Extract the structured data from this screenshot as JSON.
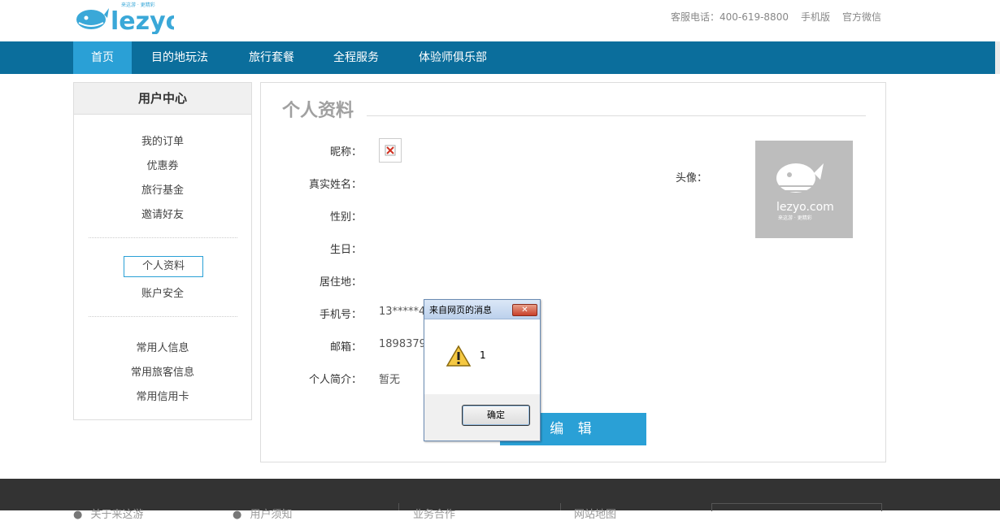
{
  "header": {
    "logo_text": "lezyo",
    "logo_tagline": "来这游 · 更精彩",
    "hotline": "客服电话：400-619-8800",
    "mobile": "手机版",
    "wechat": "官方微信"
  },
  "nav": {
    "items": [
      "首页",
      "目的地玩法",
      "旅行套餐",
      "全程服务",
      "体验师俱乐部"
    ],
    "active_index": 0
  },
  "sidebar": {
    "title": "用户中心",
    "group1": [
      "我的订单",
      "优惠券",
      "旅行基金",
      "邀请好友"
    ],
    "group2": [
      "个人资料",
      "账户安全"
    ],
    "group3": [
      "常用人信息",
      "常用旅客信息",
      "常用信用卡"
    ],
    "active_item": "个人资料"
  },
  "profile": {
    "title": "个人资料",
    "fields": [
      {
        "label": "昵称：",
        "value": ""
      },
      {
        "label": "真实姓名：",
        "value": ""
      },
      {
        "label": "性别：",
        "value": ""
      },
      {
        "label": "生日：",
        "value": ""
      },
      {
        "label": "居住地：",
        "value": ""
      },
      {
        "label": "手机号：",
        "value": "13*****4"
      },
      {
        "label": "邮箱：",
        "value": "1898379"
      },
      {
        "label": "个人简介：",
        "value": "暂无"
      }
    ],
    "avatar_label": "头像：",
    "avatar_brand": "lezyo.com",
    "avatar_tagline": "来这游 · 更精彩",
    "edit_button": "编 辑"
  },
  "dialog": {
    "title": "来自网页的消息",
    "message": "1",
    "ok_label": "确定",
    "close_label": "✕"
  },
  "footer": {
    "items": [
      "关于来这游",
      "用户须知",
      "业务合作",
      "网站地图"
    ]
  },
  "colors": {
    "nav_bg": "#0b6e9c",
    "accent": "#2aa0d6",
    "footer_bg": "#333333"
  }
}
